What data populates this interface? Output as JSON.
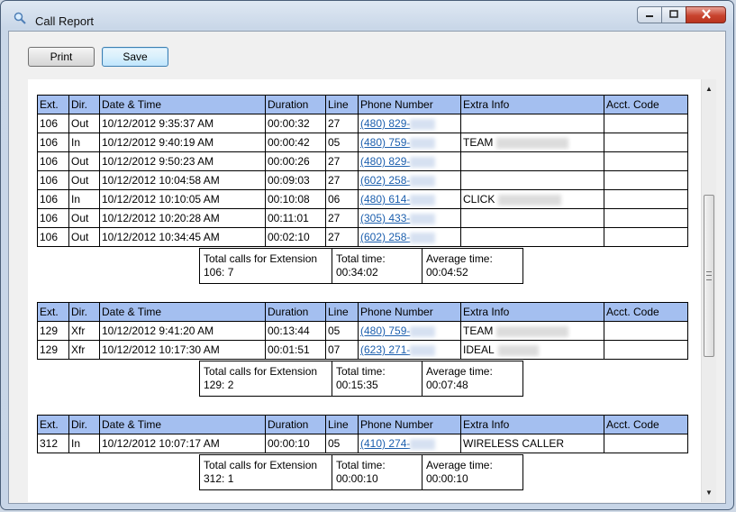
{
  "window": {
    "title": "Call Report"
  },
  "toolbar": {
    "print_label": "Print",
    "save_label": "Save"
  },
  "columns": [
    "Ext.",
    "Dir.",
    "Date & Time",
    "Duration",
    "Line",
    "Phone Number",
    "Extra Info",
    "Acct. Code"
  ],
  "sections": [
    {
      "rows": [
        {
          "ext": "106",
          "dir": "Out",
          "datetime": "10/12/2012 9:35:37 AM",
          "duration": "00:00:32",
          "line": "27",
          "phone": "(480) 829-",
          "extra": "",
          "acct": ""
        },
        {
          "ext": "106",
          "dir": "In",
          "datetime": "10/12/2012 9:40:19 AM",
          "duration": "00:00:42",
          "line": "05",
          "phone": "(480) 759-",
          "extra": "TEAM",
          "acct": ""
        },
        {
          "ext": "106",
          "dir": "Out",
          "datetime": "10/12/2012 9:50:23 AM",
          "duration": "00:00:26",
          "line": "27",
          "phone": "(480) 829-",
          "extra": "",
          "acct": ""
        },
        {
          "ext": "106",
          "dir": "Out",
          "datetime": "10/12/2012 10:04:58 AM",
          "duration": "00:09:03",
          "line": "27",
          "phone": "(602) 258-",
          "extra": "",
          "acct": ""
        },
        {
          "ext": "106",
          "dir": "In",
          "datetime": "10/12/2012 10:10:05 AM",
          "duration": "00:10:08",
          "line": "06",
          "phone": "(480) 614-",
          "extra": "CLICK",
          "acct": ""
        },
        {
          "ext": "106",
          "dir": "Out",
          "datetime": "10/12/2012 10:20:28 AM",
          "duration": "00:11:01",
          "line": "27",
          "phone": "(305) 433-",
          "extra": "",
          "acct": ""
        },
        {
          "ext": "106",
          "dir": "Out",
          "datetime": "10/12/2012 10:34:45 AM",
          "duration": "00:02:10",
          "line": "27",
          "phone": "(602) 258-",
          "extra": "",
          "acct": ""
        }
      ],
      "summary": {
        "total_calls_label": "Total calls for Extension",
        "total_calls_value": "106: 7",
        "total_time_label": "Total time:",
        "total_time_value": "00:34:02",
        "avg_time_label": "Average time:",
        "avg_time_value": "00:04:52"
      }
    },
    {
      "rows": [
        {
          "ext": "129",
          "dir": "Xfr",
          "datetime": "10/12/2012 9:41:20 AM",
          "duration": "00:13:44",
          "line": "05",
          "phone": "(480) 759-",
          "extra": "TEAM",
          "acct": ""
        },
        {
          "ext": "129",
          "dir": "Xfr",
          "datetime": "10/12/2012 10:17:30 AM",
          "duration": "00:01:51",
          "line": "07",
          "phone": "(623) 271-",
          "extra": "IDEAL",
          "acct": ""
        }
      ],
      "summary": {
        "total_calls_label": "Total calls for Extension",
        "total_calls_value": "129: 2",
        "total_time_label": "Total time:",
        "total_time_value": "00:15:35",
        "avg_time_label": "Average time:",
        "avg_time_value": "00:07:48"
      }
    },
    {
      "rows": [
        {
          "ext": "312",
          "dir": "In",
          "datetime": "10/12/2012 10:07:17 AM",
          "duration": "00:00:10",
          "line": "05",
          "phone": "(410) 274-",
          "extra": "WIRELESS CALLER",
          "acct": ""
        }
      ],
      "summary": {
        "total_calls_label": "Total calls for Extension",
        "total_calls_value": "312: 1",
        "total_time_label": "Total time:",
        "total_time_value": "00:00:10",
        "avg_time_label": "Average time:",
        "avg_time_value": "00:00:10"
      }
    }
  ],
  "icons": {
    "app": "search-icon",
    "minimize": "minimize-icon",
    "maximize": "maximize-icon",
    "close": "close-icon",
    "scroll_up": "scroll-up-arrow-icon",
    "scroll_down": "scroll-down-arrow-icon"
  }
}
